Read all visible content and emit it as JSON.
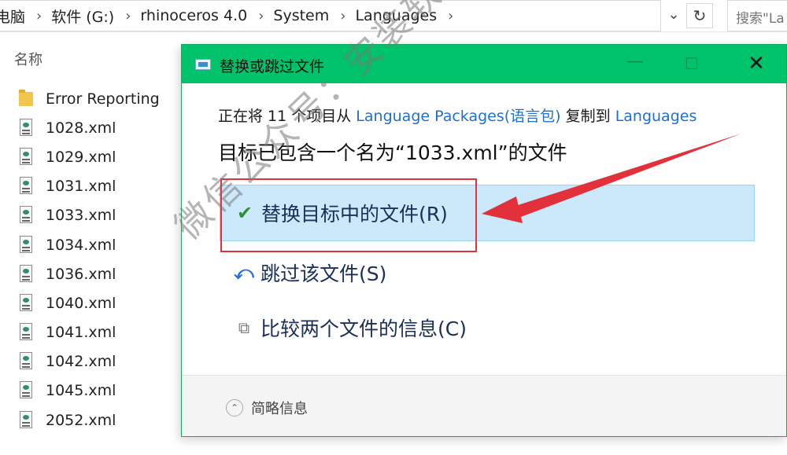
{
  "address_bar": {
    "crumbs": [
      "电脑",
      "软件 (G:)",
      "rhinoceros 4.0",
      "System",
      "Languages"
    ],
    "search_placeholder": "搜索\"La"
  },
  "file_list": {
    "column_header": "名称",
    "items": [
      {
        "name": "Error Reporting",
        "type": "folder"
      },
      {
        "name": "1028.xml",
        "type": "xml"
      },
      {
        "name": "1029.xml",
        "type": "xml"
      },
      {
        "name": "1031.xml",
        "type": "xml"
      },
      {
        "name": "1033.xml",
        "type": "xml"
      },
      {
        "name": "1034.xml",
        "type": "xml"
      },
      {
        "name": "1036.xml",
        "type": "xml"
      },
      {
        "name": "1040.xml",
        "type": "xml"
      },
      {
        "name": "1041.xml",
        "type": "xml"
      },
      {
        "name": "1042.xml",
        "type": "xml"
      },
      {
        "name": "1045.xml",
        "type": "xml"
      },
      {
        "name": "2052.xml",
        "type": "xml"
      }
    ]
  },
  "dialog": {
    "title": "替换或跳过文件",
    "status": {
      "prefix": "正在将 11 个项目从 ",
      "source": "Language Packages(语言包)",
      "middle": " 复制到 ",
      "destination": "Languages"
    },
    "headline": "目标已包含一个名为“1033.xml”的文件",
    "options": {
      "replace": "替换目标中的文件(R)",
      "skip": "跳过该文件(S)",
      "compare": "比较两个文件的信息(C)"
    },
    "details": "简略信息"
  },
  "watermark": "微信公众号：安装软件指南",
  "colors": {
    "titlebar": "#00c26a",
    "link": "#1f6fd1",
    "selected_option": "#cce8fb",
    "annotation_red": "#e2313a"
  }
}
